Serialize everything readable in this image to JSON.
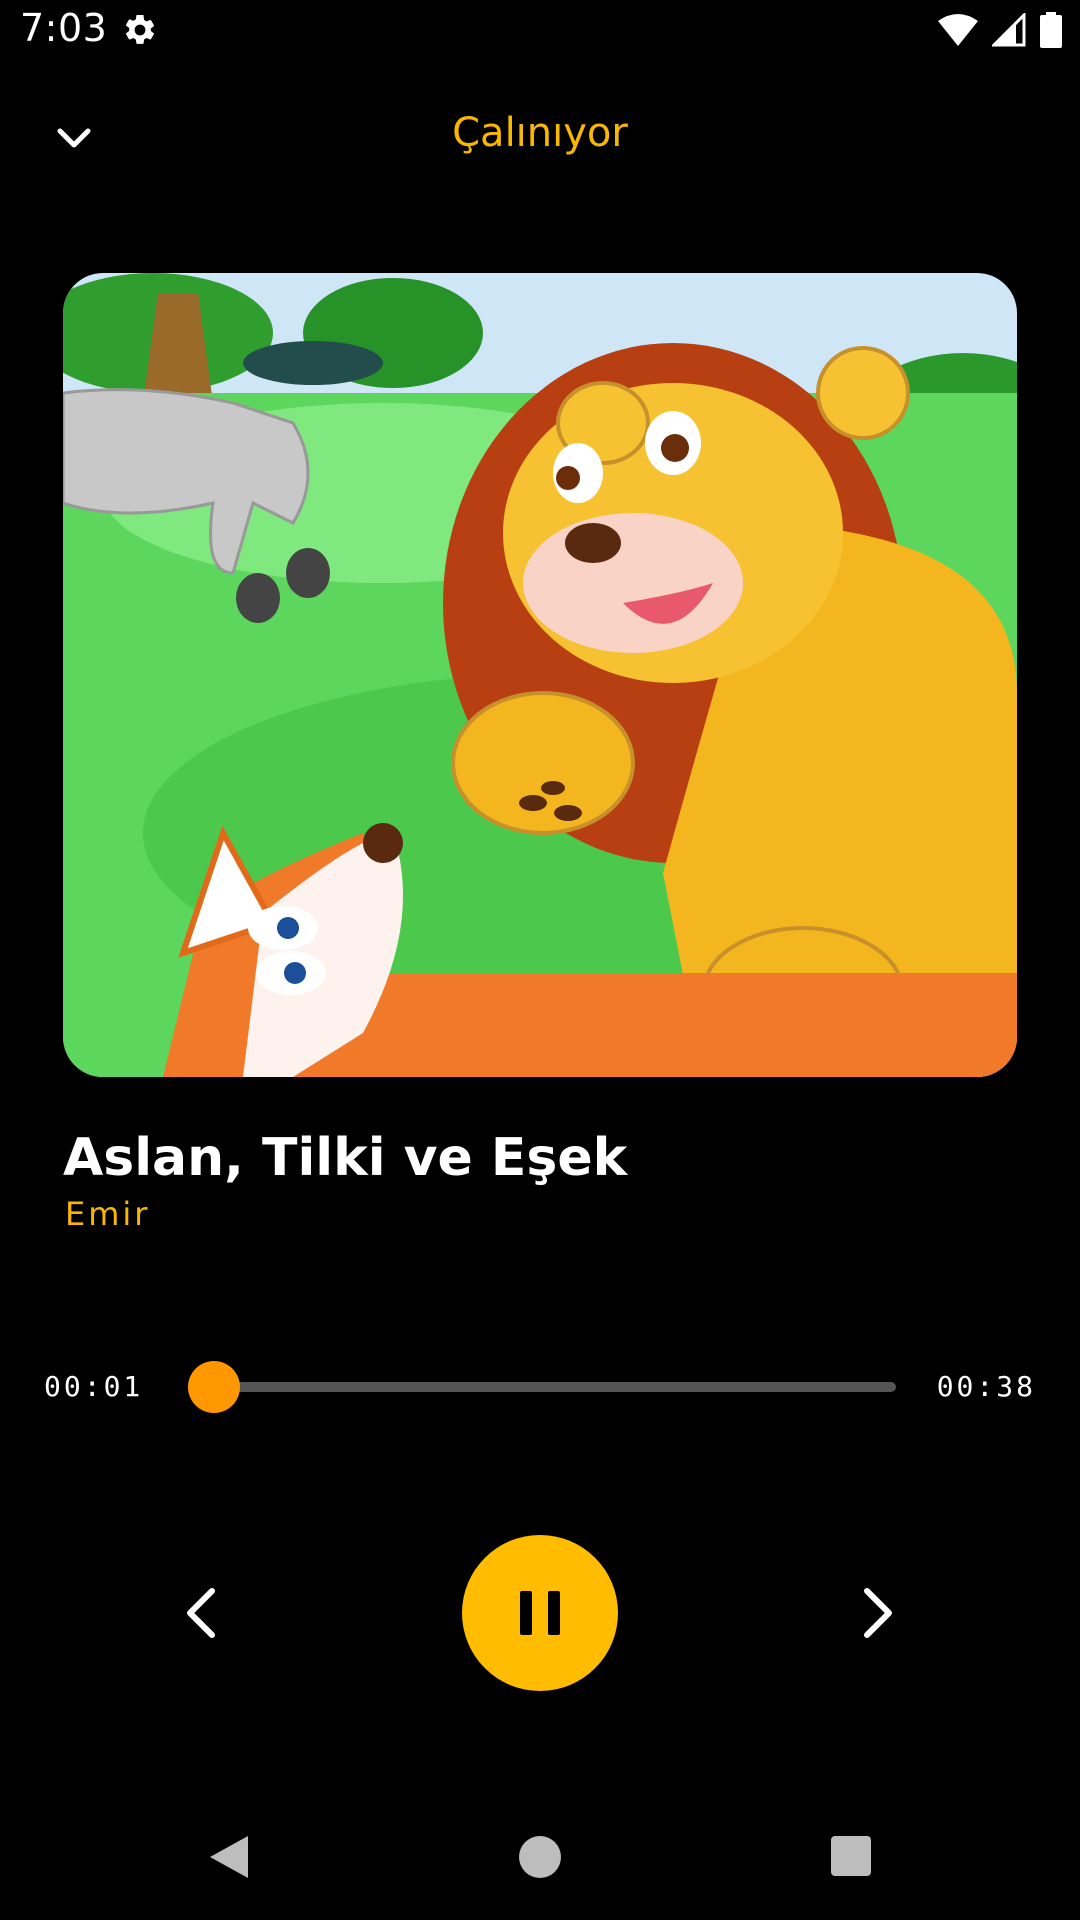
{
  "status_bar": {
    "time": "7:03",
    "icons": [
      "settings-icon",
      "wifi-icon",
      "signal-icon",
      "battery-icon"
    ]
  },
  "header": {
    "title": "Çalınıyor",
    "collapse_icon": "chevron-down-icon"
  },
  "artwork": {
    "description_icon": "album-artwork"
  },
  "track": {
    "title": "Aslan, Tilki ve Eşek",
    "artist": "Emir"
  },
  "player": {
    "current_time": "00:01",
    "total_time": "00:38",
    "progress": 0.026,
    "prev_icon": "chevron-left-icon",
    "play_pause_icon": "pause-icon",
    "next_icon": "chevron-right-icon"
  },
  "colors": {
    "accent": "#F9B700",
    "play_button": "#FFBC00",
    "seek": "#FF9800",
    "background": "#000000"
  },
  "nav_bar": {
    "icons": [
      "back-icon",
      "home-icon",
      "recents-icon"
    ]
  }
}
